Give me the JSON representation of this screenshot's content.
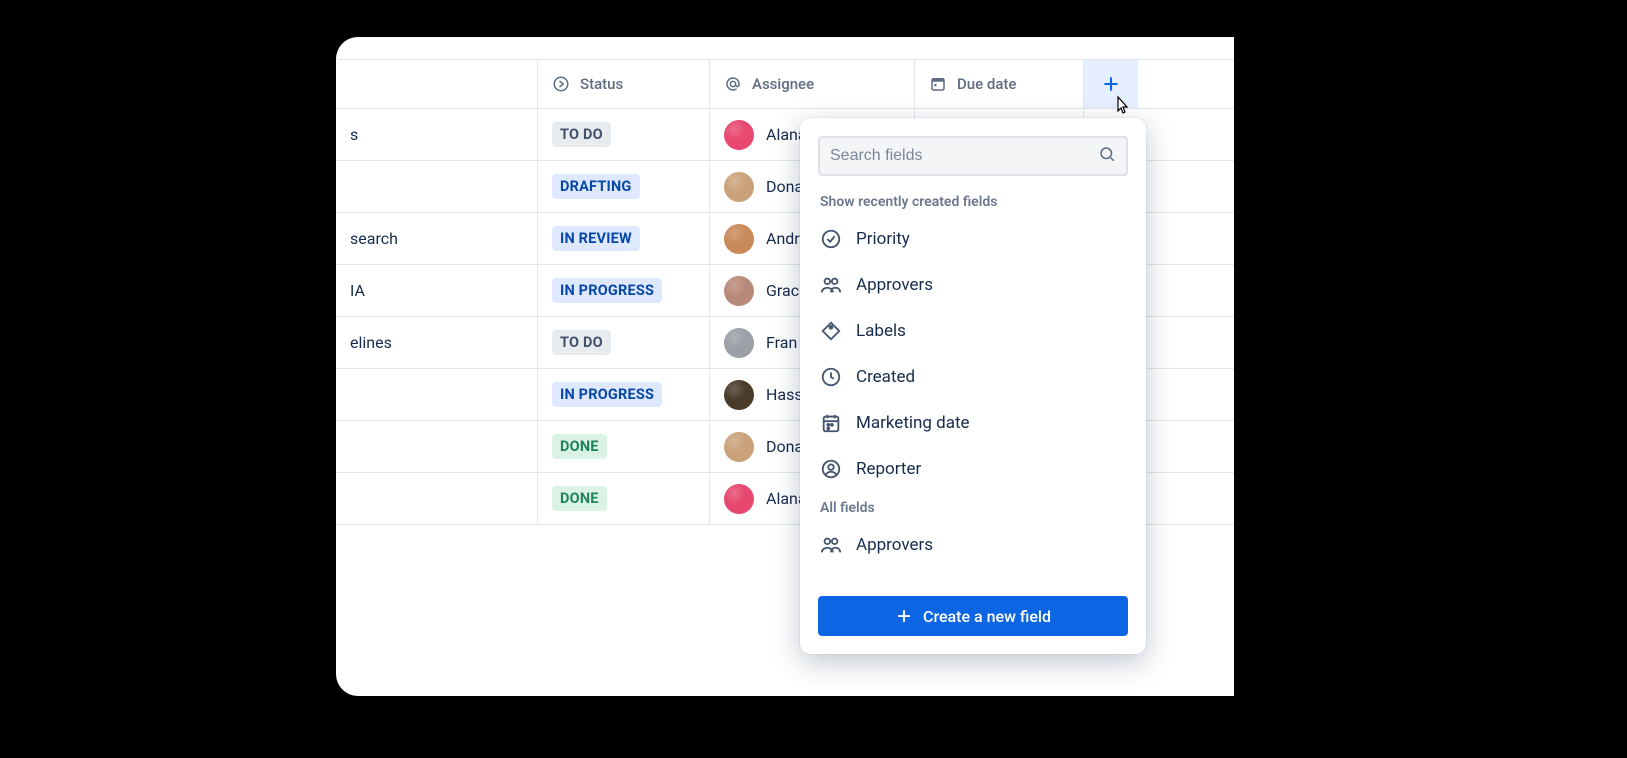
{
  "columns": {
    "status": "Status",
    "assignee": "Assignee",
    "due": "Due date"
  },
  "statuses": {
    "todo": "TO DO",
    "drafting": "DRAFTING",
    "review": "IN REVIEW",
    "progress": "IN PROGRESS",
    "done": "DONE"
  },
  "rows": [
    {
      "task_fragment": "s",
      "status": "todo",
      "assignee": "Alana",
      "avatar": "#e8476f"
    },
    {
      "task_fragment": "",
      "status": "drafting",
      "assignee": "Dona",
      "avatar": "#caa27a"
    },
    {
      "task_fragment": "search",
      "status": "review",
      "assignee": "Andr",
      "avatar": "#c98a5a"
    },
    {
      "task_fragment": "IA",
      "status": "progress",
      "assignee": "Grac",
      "avatar": "#b88a7a"
    },
    {
      "task_fragment": "elines",
      "status": "todo",
      "assignee": "Fran",
      "avatar": "#9aa0a6"
    },
    {
      "task_fragment": "",
      "status": "progress",
      "assignee": "Hass",
      "avatar": "#4a3a2a"
    },
    {
      "task_fragment": "",
      "status": "done",
      "assignee": "Dona",
      "avatar": "#caa27a"
    },
    {
      "task_fragment": "",
      "status": "done",
      "assignee": "Alana",
      "avatar": "#e8476f"
    }
  ],
  "popover": {
    "search_placeholder": "Search fields",
    "recent_label": "Show recently created fields",
    "recent_fields": [
      {
        "name": "Priority",
        "icon": "priority"
      },
      {
        "name": "Approvers",
        "icon": "people"
      },
      {
        "name": "Labels",
        "icon": "tag"
      },
      {
        "name": "Created",
        "icon": "clock"
      },
      {
        "name": "Marketing date",
        "icon": "calendar"
      },
      {
        "name": "Reporter",
        "icon": "person"
      }
    ],
    "all_label": "All fields",
    "all_fields": [
      {
        "name": "Approvers",
        "icon": "people"
      }
    ],
    "create_label": "Create a new field"
  }
}
